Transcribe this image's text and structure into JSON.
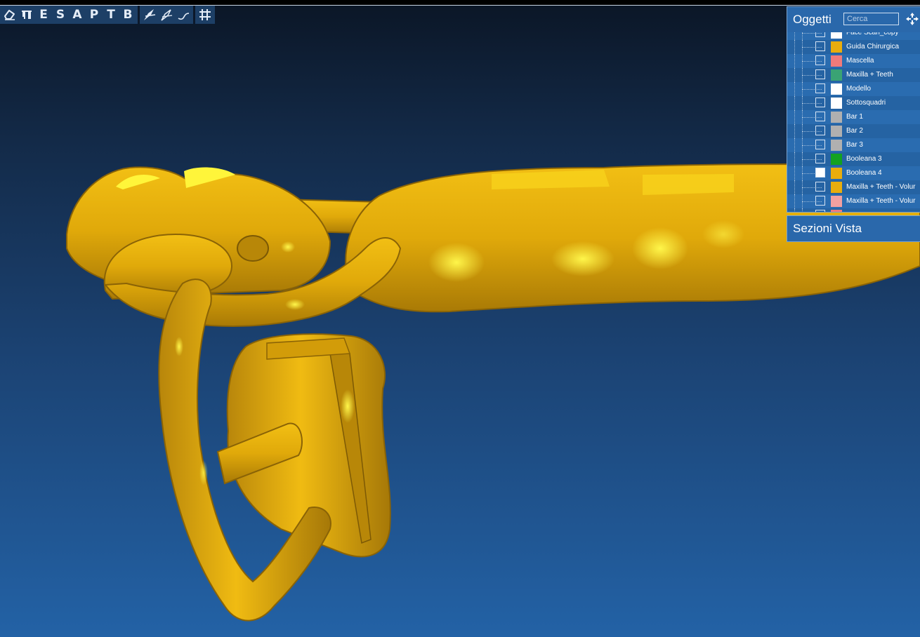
{
  "toolbar": {
    "letters": [
      "E",
      "S",
      "A",
      "P",
      "T",
      "B"
    ],
    "icons": [
      "eraser-icon",
      "pi-icon",
      "draw-surface-icon",
      "draw-curve-icon",
      "freehand-curve-icon",
      "grid-icon"
    ]
  },
  "objects_panel": {
    "title": "Oggetti",
    "search_placeholder": "Cerca",
    "items": [
      {
        "label": "Face Scan_copy",
        "color": "#ffffff",
        "checked": false
      },
      {
        "label": "Guida Chirurgica",
        "color": "#e9ad0d",
        "checked": false
      },
      {
        "label": "Mascella",
        "color": "#f07a7a",
        "checked": false
      },
      {
        "label": "Maxilla + Teeth",
        "color": "#3aa374",
        "checked": false
      },
      {
        "label": "Modello",
        "color": "#ffffff",
        "checked": false
      },
      {
        "label": "Sottosquadri",
        "color": "#ffffff",
        "checked": false
      },
      {
        "label": "Bar 1",
        "color": "#b0b0b0",
        "checked": false
      },
      {
        "label": "Bar 2",
        "color": "#b0b0b0",
        "checked": false
      },
      {
        "label": "Bar 3",
        "color": "#b0b0b0",
        "checked": false
      },
      {
        "label": "Booleana 3",
        "color": "#13a221",
        "checked": false
      },
      {
        "label": "Booleana 4",
        "color": "#e9ad0d",
        "checked": true
      },
      {
        "label": "Maxilla + Teeth - Volur",
        "color": "#e9ad0d",
        "checked": false
      },
      {
        "label": "Maxilla + Teeth - Volur",
        "color": "#f2a0a0",
        "checked": false
      },
      {
        "label": "",
        "color": "#f07a7a",
        "checked": false
      }
    ]
  },
  "sections_panel": {
    "title": "Sezioni Vista"
  },
  "colors": {
    "model": "#e9ad0d",
    "highlight": "#ffee00",
    "panel_bg": "#2a68ab"
  }
}
